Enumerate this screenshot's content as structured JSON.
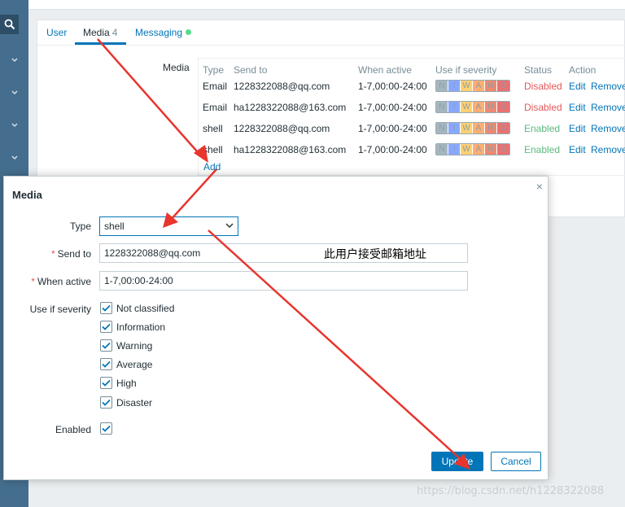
{
  "tabs": [
    {
      "label": "User"
    },
    {
      "label": "Media",
      "count": "4"
    },
    {
      "label": "Messaging"
    }
  ],
  "media_section": {
    "label": "Media",
    "columns": [
      "Type",
      "Send to",
      "When active",
      "Use if severity",
      "Status",
      "Action"
    ],
    "rows": [
      {
        "type": "Email",
        "send_to": "1228322088@qq.com",
        "when_active": "1-7,00:00-24:00",
        "status": "Disabled",
        "edit": "Edit",
        "remove": "Remove"
      },
      {
        "type": "Email",
        "send_to": "ha1228322088@163.com",
        "when_active": "1-7,00:00-24:00",
        "status": "Disabled",
        "edit": "Edit",
        "remove": "Remove"
      },
      {
        "type": "shell",
        "send_to": "1228322088@qq.com",
        "when_active": "1-7,00:00-24:00",
        "status": "Enabled",
        "edit": "Edit",
        "remove": "Remove"
      },
      {
        "type": "shell",
        "send_to": "ha1228322088@163.com",
        "when_active": "1-7,00:00-24:00",
        "status": "Enabled",
        "edit": "Edit",
        "remove": "Remove"
      }
    ],
    "severity_letters": [
      "N",
      "I",
      "W",
      "A",
      "H",
      "D"
    ],
    "severity_colors": [
      "#97aab3",
      "#7499ff",
      "#ffc859",
      "#ffa059",
      "#e97659",
      "#e45959"
    ],
    "add_label": "Add"
  },
  "dialog": {
    "title": "Media",
    "close": "×",
    "type_label": "Type",
    "type_value": "shell",
    "send_to_label": "Send to",
    "send_to_value": "1228322088@qq.com",
    "send_to_annotation": "此用户接受邮箱地址",
    "when_active_label": "When active",
    "when_active_value": "1-7,00:00-24:00",
    "severity_label": "Use if severity",
    "severities": [
      "Not classified",
      "Information",
      "Warning",
      "Average",
      "High",
      "Disaster"
    ],
    "enabled_label": "Enabled",
    "update_label": "Update",
    "cancel_label": "Cancel"
  },
  "watermark": "https://blog.csdn.net/h1228322088",
  "colors": {
    "accent": "#0275b8",
    "sidebar": "#456e8e",
    "annotation_arrow": "#e8352e"
  }
}
